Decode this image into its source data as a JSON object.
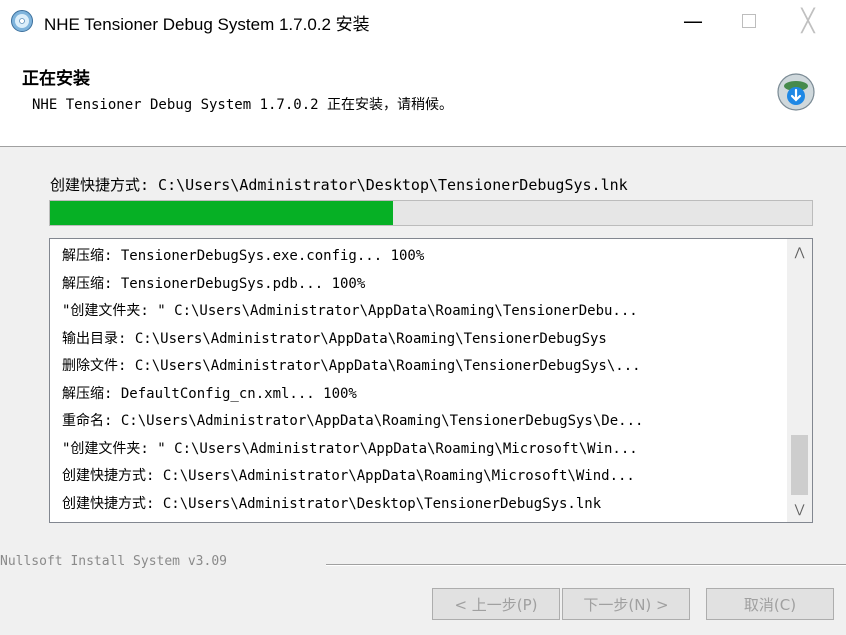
{
  "window": {
    "title": "NHE Tensioner Debug System 1.7.0.2 安装",
    "icons": {
      "app": "installer-disc-icon",
      "minimize": "minimize-icon",
      "maximize": "maximize-icon",
      "close": "close-icon"
    },
    "minimize_glyph": "—",
    "close_glyph": "╳"
  },
  "header": {
    "title": "正在安装",
    "subtitle": "NHE Tensioner Debug System 1.7.0.2 正在安装，请稍候。",
    "logo_icon": "installer-cd-download-icon"
  },
  "status": {
    "text": "创建快捷方式: C:\\Users\\Administrator\\Desktop\\TensionerDebugSys.lnk",
    "progress_percent": 45,
    "progress_color": "#06b025"
  },
  "log": {
    "lines": [
      "解压缩: TensionerDebugSys.exe.config... 100%",
      "解压缩: TensionerDebugSys.pdb... 100%",
      "\"创建文件夹: \" C:\\Users\\Administrator\\AppData\\Roaming\\TensionerDebu...",
      "输出目录: C:\\Users\\Administrator\\AppData\\Roaming\\TensionerDebugSys",
      "删除文件: C:\\Users\\Administrator\\AppData\\Roaming\\TensionerDebugSys\\...",
      "解压缩: DefaultConfig_cn.xml... 100%",
      "重命名: C:\\Users\\Administrator\\AppData\\Roaming\\TensionerDebugSys\\De...",
      "\"创建文件夹: \" C:\\Users\\Administrator\\AppData\\Roaming\\Microsoft\\Win...",
      "创建快捷方式: C:\\Users\\Administrator\\AppData\\Roaming\\Microsoft\\Wind...",
      "创建快捷方式: C:\\Users\\Administrator\\Desktop\\TensionerDebugSys.lnk"
    ],
    "scroll_up_glyph": "⋀",
    "scroll_down_glyph": "⋁"
  },
  "footer": {
    "branding": "Nullsoft Install System v3.09",
    "back_label": "< 上一步(P)",
    "next_label": "下一步(N) >",
    "cancel_label": "取消(C)"
  }
}
